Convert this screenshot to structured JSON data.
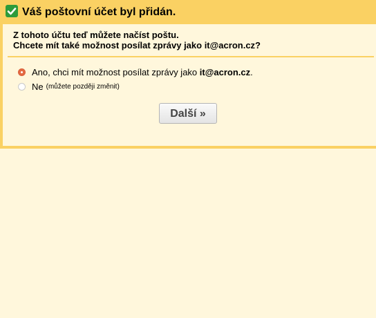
{
  "header": {
    "title": "Váš poštovní účet byl přidán.",
    "icon": "check-icon"
  },
  "question": {
    "line1": "Z tohoto účtu teď můžete načíst poštu.",
    "line2": "Chcete mít také možnost posílat zprávy jako it@acron.cz?"
  },
  "options": {
    "yes": {
      "label_prefix": "Ano, chci mít možnost posílat zprávy jako ",
      "email": "it@acron.cz",
      "label_suffix": ".",
      "selected": true
    },
    "no": {
      "label": "Ne",
      "note": "(můžete později změnit)",
      "selected": false
    }
  },
  "actions": {
    "next_label": "Další »"
  },
  "colors": {
    "accent": "#fad163",
    "background": "#fff7dc",
    "check": "#2d9b3a",
    "radio_selected": "#e46a43"
  }
}
